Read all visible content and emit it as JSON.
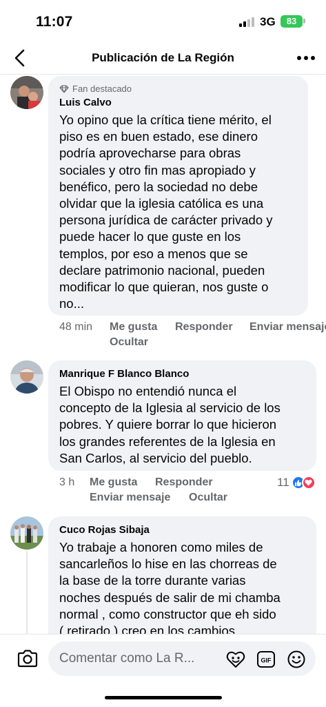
{
  "status": {
    "time": "11:07",
    "network": "3G",
    "battery": "83"
  },
  "header": {
    "title": "Publicación de La Región"
  },
  "comments": [
    {
      "badge": "Fan destacado",
      "author": "Luis Calvo",
      "lines": [
        "Yo opino que la crítica tiene mérito, el",
        "piso es en buen estado, ese dinero",
        "podría aprovecharse para obras",
        "sociales y otro fin mas apropiado y",
        "benéfico, pero la sociedad no debe",
        "olvidar que la iglesia católica es una",
        "persona jurídica de carácter privado y",
        "puede hacer lo que guste en los",
        "templos, por eso a menos que se",
        "declare patrimonio nacional, pueden",
        "modificar lo que quieran, nos guste o",
        "no..."
      ],
      "time": "48 min",
      "like": "Me gusta",
      "reply": "Responder",
      "send": "Enviar mensaje",
      "hide": "Ocultar"
    },
    {
      "author": "Manrique F Blanco Blanco",
      "lines": [
        "El Obispo no entendió nunca el",
        "concepto de la Iglesia al servicio de los",
        "pobres. Y quiere borrar lo que hicieron",
        "los grandes referentes de la Iglesia en",
        "San Carlos, al servicio del pueblo."
      ],
      "time": "3 h",
      "like": "Me gusta",
      "reply": "Responder",
      "send": "Enviar mensaje",
      "hide": "Ocultar",
      "reactions": "11"
    },
    {
      "author": "Cuco Rojas Sibaja",
      "lines": [
        "Yo trabaje a honoren como miles de",
        "sancarleños lo hise en las chorreas de",
        "la base de la torre durante varias",
        "noches después de salir de mi chamba",
        "normal , como constructor que eh sido",
        "( retirado ) creo en los cambios"
      ]
    }
  ],
  "composer": {
    "placeholder": "Comentar como La R..."
  },
  "icons": {
    "back": "chevron-left-icon",
    "more": "more-horizontal-icon",
    "fan": "diamond-icon",
    "camera": "camera-icon",
    "avatar_frame": "avatar-frame-icon",
    "gif": "gif-icon",
    "emoji": "emoji-icon",
    "like": "like-reaction-icon",
    "love": "love-reaction-icon"
  },
  "colors": {
    "like_blue": "#1877f2",
    "love_red": "#f33e58",
    "battery_green": "#34c759",
    "bubble": "#f0f2f5",
    "secondary_text": "#65676b"
  }
}
